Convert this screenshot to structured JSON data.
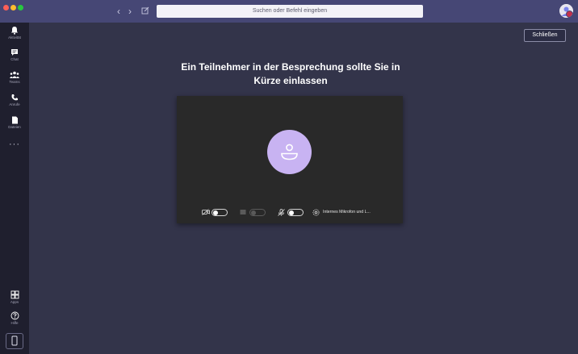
{
  "window": {
    "search_placeholder": "Suchen oder Befehl eingeben",
    "nav_back_icon": "chevron-left-icon",
    "nav_forward_icon": "chevron-right-icon",
    "compose_icon": "compose-icon",
    "status_color": "#c4314b"
  },
  "rail": {
    "items": [
      {
        "label": "Aktivität",
        "icon": "bell-icon"
      },
      {
        "label": "Chat",
        "icon": "chat-icon"
      },
      {
        "label": "Teams",
        "icon": "teams-icon"
      },
      {
        "label": "Anrufe",
        "icon": "phone-icon"
      },
      {
        "label": "Dateien",
        "icon": "file-icon"
      }
    ],
    "more_label": "···",
    "bottom": [
      {
        "label": "Apps",
        "icon": "apps-icon"
      },
      {
        "label": "Hilfe",
        "icon": "help-icon"
      }
    ],
    "device_icon": "mobile-icon"
  },
  "main": {
    "close_label": "Schließen",
    "headline_line1": "Ein Teilnehmer in der Besprechung sollte Sie in",
    "headline_line2": "Kürze einlassen"
  },
  "preview": {
    "avatar_color": "#c8b3f2",
    "camera_on": false,
    "blur_on": false,
    "blur_enabled": false,
    "mic_on": false,
    "device_label": "Internes Mikrofon und L..."
  },
  "colors": {
    "titlebar": "#464775",
    "rail": "#1f1f2e",
    "stage": "#33344a",
    "preview": "#292929"
  }
}
